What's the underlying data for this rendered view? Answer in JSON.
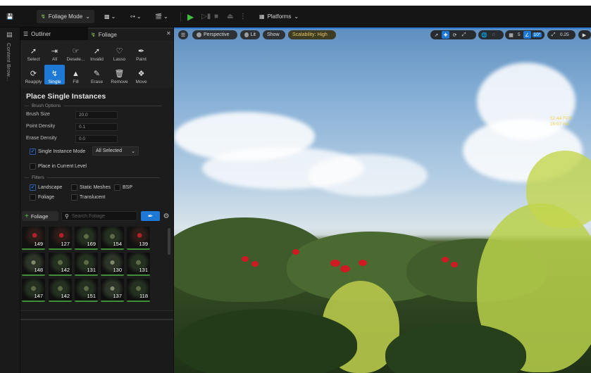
{
  "toolbar": {
    "mode_label": "Foliage Mode",
    "platforms_label": "Platforms"
  },
  "left_strip": {
    "content_browser_label": "Content Brow..."
  },
  "panel": {
    "tabs": {
      "outliner": "Outliner",
      "foliage": "Foliage"
    },
    "tools_row1": [
      "Select",
      "All",
      "Desele...",
      "Invalid",
      "Lasso",
      "Paint"
    ],
    "tools_row2": [
      "Reapply",
      "Single",
      "Fill",
      "Erase",
      "Remove",
      "Move"
    ],
    "active_tool": "Single",
    "section_title": "Place Single Instances",
    "brush_options": {
      "header": "Brush Options",
      "brush_size_label": "Brush Size",
      "brush_size_value": "20.0",
      "point_density_label": "Point Density",
      "point_density_value": "0.1",
      "erase_density_label": "Erase Density",
      "erase_density_value": "0.0",
      "single_instance_mode_label": "Single Instance Mode",
      "single_instance_mode_checked": true,
      "single_instance_mode_value": "All Selected",
      "place_in_current_level_label": "Place in Current Level",
      "place_in_current_level_checked": false
    },
    "filters": {
      "header": "Filters",
      "landscape_label": "Landscape",
      "landscape_checked": true,
      "static_meshes_label": "Static Meshes",
      "static_meshes_checked": false,
      "bsp_label": "BSP",
      "bsp_checked": false,
      "foliage_label": "Foliage",
      "foliage_checked": false,
      "translucent_label": "Translucent",
      "translucent_checked": false
    },
    "foliage_bar": {
      "add_label": "Foliage",
      "search_placeholder": "Search Foliage"
    },
    "foliage_counts": [
      [
        "149",
        "127",
        "169",
        "154",
        "139"
      ],
      [
        "148",
        "142",
        "131",
        "130",
        "131"
      ],
      [
        "147",
        "142",
        "151",
        "137",
        "118"
      ]
    ]
  },
  "viewport": {
    "perspective_label": "Perspective",
    "lit_label": "Lit",
    "show_label": "Show",
    "scalability_label": "Scalability: High",
    "grid_value": "5",
    "angle_value": "10°",
    "scale_value": "0.25",
    "fps": "52.44 FPS",
    "frame_ms": "19.07 ms"
  },
  "colors": {
    "accent": "#1e78d6",
    "play": "#3fbf3f",
    "add_plus": "#5cc24a",
    "scalability_text": "#e6c86a",
    "fps_text": "#f2d24b"
  }
}
